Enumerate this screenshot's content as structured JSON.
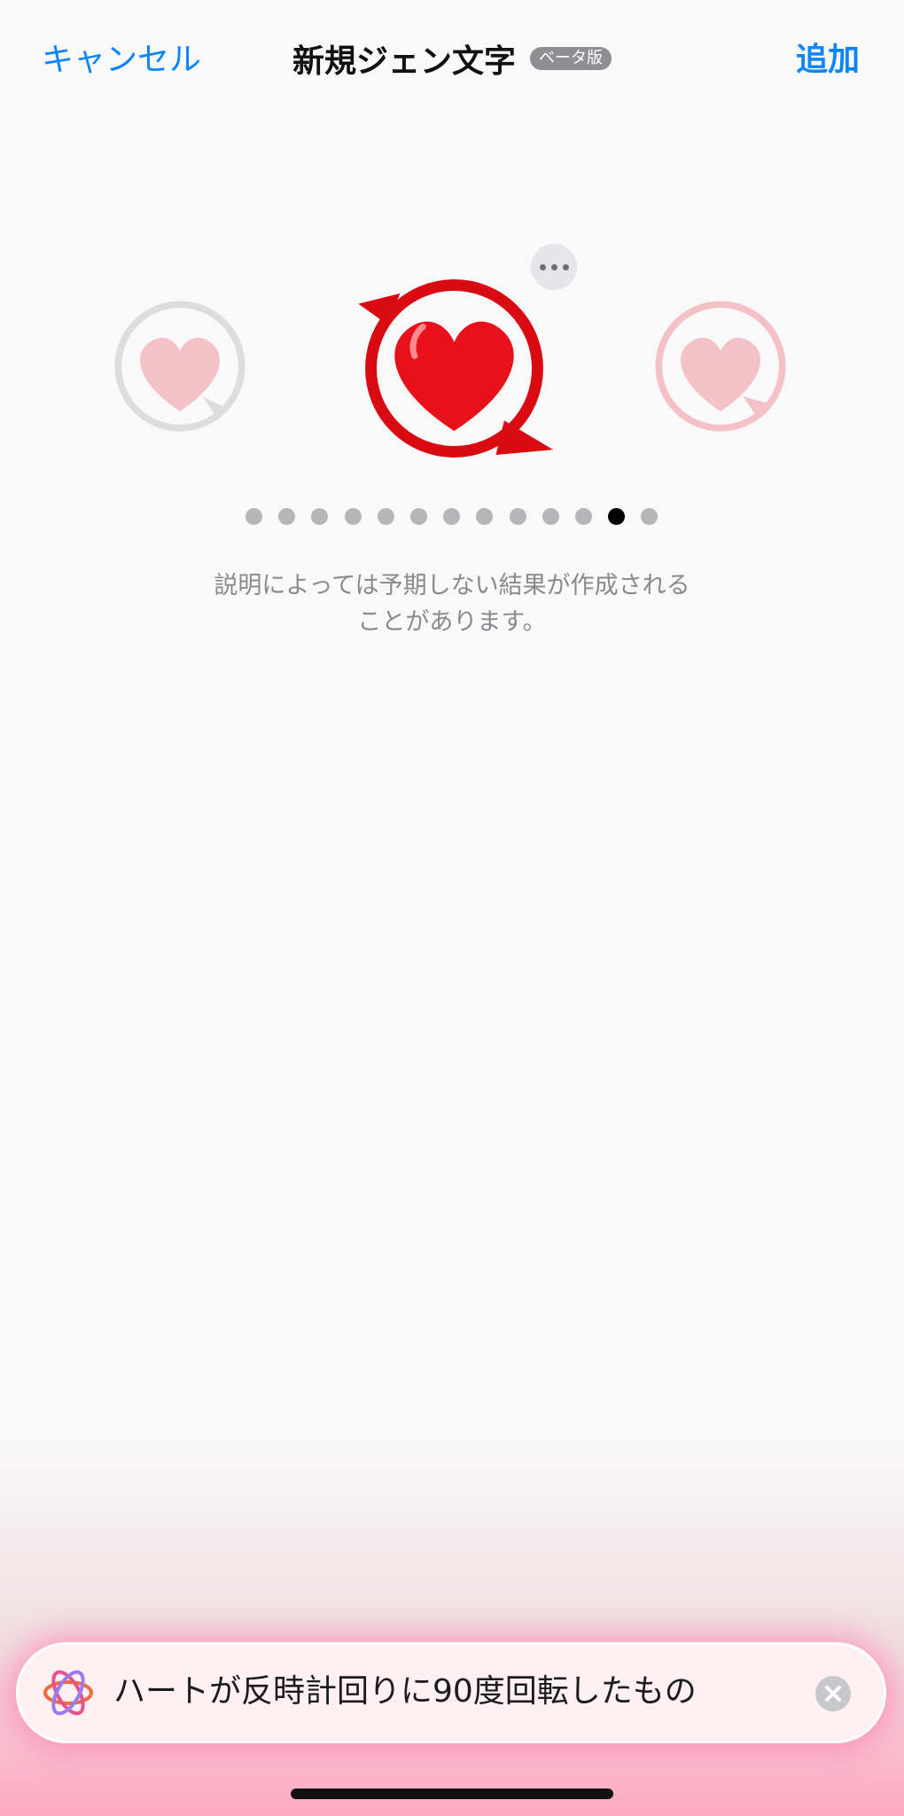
{
  "nav": {
    "cancel_label": "キャンセル",
    "title": "新規ジェン文字",
    "beta_badge": "ベータ版",
    "add_label": "追加"
  },
  "carousel": {
    "items": [
      {
        "icon": "heart-rotate-icon",
        "state": "previous"
      },
      {
        "icon": "heart-rotate-icon",
        "state": "selected"
      },
      {
        "icon": "heart-rotate-icon",
        "state": "next"
      }
    ],
    "more_icon": "ellipsis-icon"
  },
  "pager": {
    "count": 13,
    "active_index": 11
  },
  "disclaimer": {
    "line1": "説明によっては予期しない結果が作成される",
    "line2": "ことがあります。"
  },
  "prompt": {
    "icon": "image-playground-icon",
    "text": "ハートが反時計回りに90度回転したもの",
    "clear_icon": "clear-icon"
  },
  "colors": {
    "accent": "#0a84ff",
    "heart": "#e8101a",
    "glow": "#ff8fb4"
  }
}
